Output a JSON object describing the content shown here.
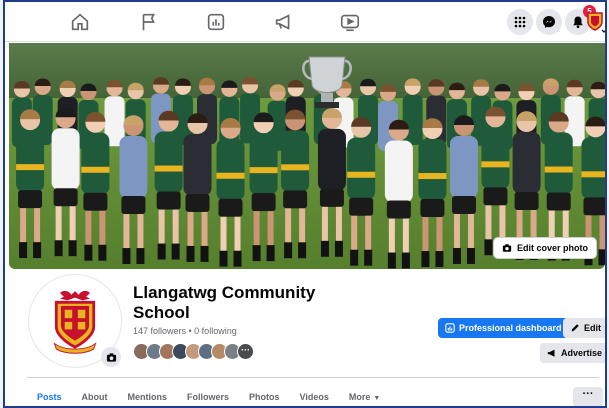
{
  "nav": {
    "notification_count": "5"
  },
  "cover": {
    "edit_label": "Edit cover photo"
  },
  "profile": {
    "name": "Llangatwg Community School",
    "stats": "147 followers • 0 following",
    "more_followers": "···"
  },
  "actions": {
    "dashboard_label": "Professional dashboard",
    "edit_label": "Edit",
    "advertise_label": "Advertise"
  },
  "tabs": {
    "items": [
      {
        "label": "Posts"
      },
      {
        "label": "About"
      },
      {
        "label": "Mentions"
      },
      {
        "label": "Followers"
      },
      {
        "label": "Photos"
      },
      {
        "label": "Videos"
      },
      {
        "label": "More"
      }
    ],
    "overflow_label": "···"
  },
  "colors": {
    "accent": "#1877f2",
    "notification": "#e41e3f",
    "kit_green": "#1f5a3a",
    "kit_gold": "#e8b521",
    "crest_red": "#c8102e"
  },
  "icons": [
    "home-icon",
    "flag-icon",
    "dashboard-icon",
    "megaphone-icon",
    "video-icon",
    "menu-grid-icon",
    "messenger-icon",
    "bell-icon",
    "camera-icon",
    "pencil-icon",
    "advertise-icon"
  ]
}
